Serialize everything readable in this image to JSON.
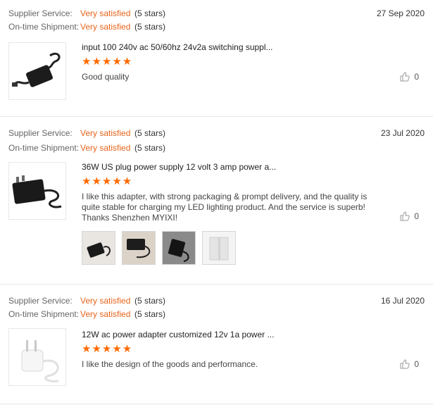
{
  "labels": {
    "supplier": "Supplier Service:",
    "shipment": "On-time Shipment:"
  },
  "reviews": [
    {
      "supplier_rating": "Very satisfied",
      "supplier_stars": "(5 stars)",
      "shipment_rating": "Very satisfied",
      "shipment_stars": "(5 stars)",
      "date": "27 Sep 2020",
      "product_title": "input 100 240v ac 50/60hz 24v2a switching suppl...",
      "stars": "★★★★★",
      "comment": "Good quality",
      "likes": "0"
    },
    {
      "supplier_rating": "Very satisfied",
      "supplier_stars": "(5 stars)",
      "shipment_rating": "Very satisfied",
      "shipment_stars": "(5 stars)",
      "date": "23 Jul 2020",
      "product_title": "36W US plug power supply 12 volt 3 amp power a...",
      "stars": "★★★★★",
      "comment": "I like this adapter, with strong packaging & prompt delivery, and the quality is quite stable for charging my LED lighting product. And the service is superb! Thanks Shenzhen MYIXI!",
      "likes": "0"
    },
    {
      "supplier_rating": "Very satisfied",
      "supplier_stars": "(5 stars)",
      "shipment_rating": "Very satisfied",
      "shipment_stars": "(5 stars)",
      "date": "16 Jul 2020",
      "product_title": "12W ac power adapter customized 12v 1a power ...",
      "stars": "★★★★★",
      "comment": "I like the design of the goods and performance.",
      "likes": "0"
    }
  ],
  "colors": {
    "accent": "#e8641c",
    "star": "#ff6a00"
  }
}
